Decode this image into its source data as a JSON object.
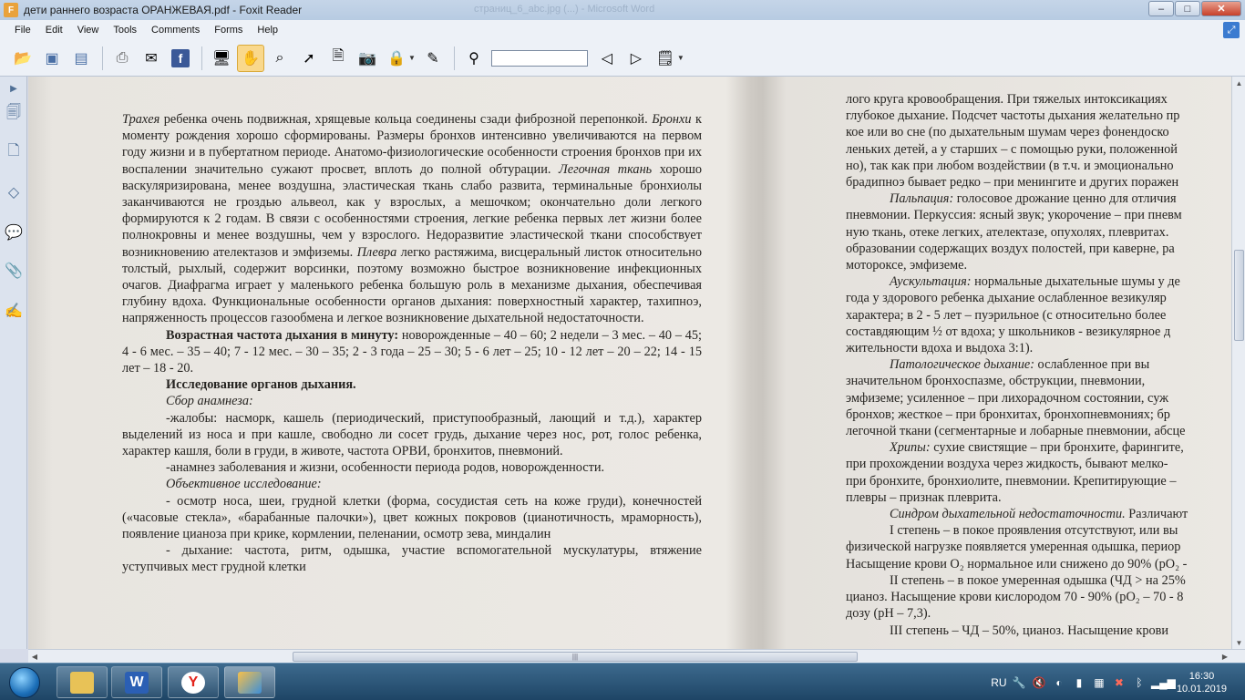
{
  "window": {
    "title": "дети раннего возраста ОРАНЖЕВАЯ.pdf - Foxit Reader",
    "faded_title": "страниц_6_abc.jpg (...) - Microsoft Word",
    "minimize": "–",
    "maximize": "□",
    "close": "✕"
  },
  "menu": [
    "File",
    "Edit",
    "View",
    "Tools",
    "Comments",
    "Forms",
    "Help"
  ],
  "toolbar": {
    "search_value": "",
    "icons": [
      "open-folder",
      "save",
      "save-as",
      "print",
      "email",
      "facebook",
      "monitor",
      "hand-tool",
      "zoom-selection",
      "select-pointer",
      "text-select",
      "snapshot",
      "rms-lock",
      "typewriter",
      "binoculars",
      "prev-search",
      "next-search",
      "export"
    ]
  },
  "document": {
    "left_page": [
      {
        "parts": [
          {
            "t": "Трахея",
            "s": "i"
          },
          {
            "t": " ребенка очень подвижная, хрящевые кольца соединены сзади фиброзной перепонкой. "
          },
          {
            "t": "Бронхи",
            "s": "i"
          },
          {
            "t": " к моменту рождения хорошо сформированы. Размеры бронхов интенсивно увеличиваются на первом году жизни и в пубертатном периоде. Анатомо-физиологические особенности строения бронхов при их воспалении значительно сужают просвет, вплоть до полной обтурации. "
          },
          {
            "t": "Легочная ткань",
            "s": "i"
          },
          {
            "t": " хорошо васкуляризирована, менее воздушна, эластическая ткань слабо развита, терминальные бронхиолы заканчиваются не гроздью альвеол, как у взрослых, а мешочком; окончательно доли легкого формируются к 2 годам. В связи с особенностями строения, легкие ребенка первых лет жизни более полнокровны и менее воздушны, чем у взрослого. Недоразвитие эластической ткани способствует возникновению ателектазов и эмфиземы. "
          },
          {
            "t": "Плевра",
            "s": "i"
          },
          {
            "t": " легко растяжима, висцеральный листок относительно толстый, рыхлый, содержит ворсинки, поэтому возможно быстрое возникновение инфекционных очагов. Диафрагма играет  у маленького ребенка большую роль в механизме дыхания, обеспечивая глубину вдоха. Функциональные особенности органов дыхания: поверхностный характер, тахипноэ, напряженность процессов газообмена и легкое возникновение дыхательной недостаточности."
          }
        ]
      },
      {
        "indent": true,
        "parts": [
          {
            "t": "Возрастная частота дыхания в минуту:",
            "s": "b"
          },
          {
            "t": " новорожденные – 40 – 60; 2 недели – 3 мес. – 40 – 45; 4 - 6 мес. – 35 – 40; 7 - 12 мес. – 30 – 35; 2 - 3 года – 25 – 30; 5 - 6 лет – 25; 10 - 12 лет – 20 – 22; 14 - 15 лет – 18 - 20."
          }
        ]
      },
      {
        "indent": true,
        "parts": [
          {
            "t": "Исследование органов дыхания.",
            "s": "b"
          }
        ]
      },
      {
        "indent": true,
        "parts": [
          {
            "t": "Сбор анамнеза:",
            "s": "i"
          }
        ]
      },
      {
        "indent": true,
        "parts": [
          {
            "t": "-жалобы: насморк, кашель (периодический, приступообразный, лающий и т.д.), характер выделений из носа и при кашле, свободно ли сосет грудь, дыхание через нос, рот, голос ребенка, характер кашля, боли в груди, в животе, частота ОРВИ, бронхитов, пневмоний."
          }
        ]
      },
      {
        "indent": true,
        "parts": [
          {
            "t": "-анамнез заболевания и жизни, особенности периода родов, новорожденности."
          }
        ]
      },
      {
        "indent": true,
        "parts": [
          {
            "t": "Объективное исследование:",
            "s": "i"
          }
        ]
      },
      {
        "indent": true,
        "parts": [
          {
            "t": "- осмотр носа, шеи, грудной клетки (форма, сосудистая сеть на коже груди), конечностей («часовые стекла», «барабанные палочки»), цвет кожных покровов (цианотичность, мраморность), появление цианоза при крике, кормлении, пеленании, осмотр зева, миндалин"
          }
        ]
      },
      {
        "indent": true,
        "parts": [
          {
            "t": "- дыхание: частота, ритм, одышка, участие вспомогательной мускулатуры, втяжение уступчивых мест грудной клетки"
          }
        ]
      }
    ],
    "right_page": [
      {
        "parts": [
          {
            "t": "лого круга кровообращения. При тяжелых интоксикациях"
          }
        ]
      },
      {
        "parts": [
          {
            "t": "глубокое дыхание. Подсчет частоты дыхания желательно пр"
          }
        ]
      },
      {
        "parts": [
          {
            "t": "кое или во сне (по дыхательным шумам через фонендоско"
          }
        ]
      },
      {
        "parts": [
          {
            "t": "леньких детей, а у старших – с помощью руки, положенной"
          }
        ]
      },
      {
        "parts": [
          {
            "t": "но), так как при любом воздействии (в т.ч. и эмоционально"
          }
        ]
      },
      {
        "parts": [
          {
            "t": "брадипноэ бывает редко – при менингите и других поражен"
          }
        ]
      },
      {
        "indent": true,
        "parts": [
          {
            "t": "Пальпация:",
            "s": "i"
          },
          {
            "t": " голосовое дрожание ценно для отличия"
          }
        ]
      },
      {
        "parts": [
          {
            "t": "пневмонии. Перкуссия: ясный звук; укорочение – при пневм"
          }
        ]
      },
      {
        "parts": [
          {
            "t": "ную ткань, отеке легких, ателектазе, опухолях, плевритах."
          }
        ]
      },
      {
        "parts": [
          {
            "t": "образовании содержащих воздух полостей, при каверне, ра"
          }
        ]
      },
      {
        "parts": [
          {
            "t": "моторoксе, эмфиземе."
          }
        ]
      },
      {
        "indent": true,
        "parts": [
          {
            "t": "Аускультация:",
            "s": "i"
          },
          {
            "t": " нормальные дыхательные шумы у де"
          }
        ]
      },
      {
        "parts": [
          {
            "t": "года у здорового ребенка дыхание ослабленное везикуляр"
          }
        ]
      },
      {
        "parts": [
          {
            "t": "характера; в 2 - 5 лет – пуэрильное (с относительно более"
          }
        ]
      },
      {
        "parts": [
          {
            "t": "составдяющим ½ от вдоха;  у школьников - везикулярное д"
          }
        ]
      },
      {
        "parts": [
          {
            "t": "жительности вдоха и выдоха 3:1)."
          }
        ]
      },
      {
        "indent": true,
        "parts": [
          {
            "t": "Патологическое дыхание:",
            "s": "i"
          },
          {
            "t": " ослабленное при вы"
          }
        ]
      },
      {
        "parts": [
          {
            "t": "значительном бронхоспазме, обструкции, пневмонии,"
          }
        ]
      },
      {
        "parts": [
          {
            "t": "эмфиземе; усиленное – при лихорадочном состоянии, суж"
          }
        ]
      },
      {
        "parts": [
          {
            "t": "бронхов; жесткое – при бронхитах, бронхопневмониях; бр"
          }
        ]
      },
      {
        "parts": [
          {
            "t": "легочной ткани (сегментарные и лобарные пневмонии, абсце"
          }
        ]
      },
      {
        "indent": true,
        "parts": [
          {
            "t": "Хрипы:",
            "s": "i"
          },
          {
            "t": " сухие свистящие – при бронхите, фарингите,"
          }
        ]
      },
      {
        "parts": [
          {
            "t": "при прохождении воздуха через жидкость, бывают мелко-"
          }
        ]
      },
      {
        "parts": [
          {
            "t": "при бронхите, бронхиолите, пневмонии. Крепитирующие –"
          }
        ]
      },
      {
        "parts": [
          {
            "t": "плевры – признак плеврита."
          }
        ]
      },
      {
        "indent": true,
        "parts": [
          {
            "t": "Синдром дыхательной недостаточности.",
            "s": "i"
          },
          {
            "t": " Различают"
          }
        ]
      },
      {
        "indent": true,
        "parts": [
          {
            "t": "I степень – в покое проявления отсутствуют, или вы"
          }
        ]
      },
      {
        "parts": [
          {
            "t": "физической нагрузке появляется умеренная одышка, периор"
          }
        ]
      },
      {
        "parts": [
          {
            "t": "Насыщение крови O₂ нормальное или снижено до 90% (pO₂ -"
          }
        ]
      },
      {
        "indent": true,
        "parts": [
          {
            "t": "II степень – в покое умеренная одышка (ЧД > на 25%"
          }
        ]
      },
      {
        "parts": [
          {
            "t": "цианоз. Насыщение крови кислородом 70 - 90% (pO₂ – 70 - 8"
          }
        ]
      },
      {
        "parts": [
          {
            "t": "дозу (pH – 7,3)."
          }
        ]
      },
      {
        "indent": true,
        "parts": [
          {
            "t": "III степень – ЧД – 50%, цианоз. Насыщение крови"
          }
        ]
      }
    ]
  },
  "taskbar": {
    "apps": [
      {
        "name": "explorer",
        "label": ""
      },
      {
        "name": "word",
        "label": "W"
      },
      {
        "name": "yandex",
        "label": "Y"
      },
      {
        "name": "foxit",
        "label": ""
      }
    ],
    "language": "RU",
    "time": "16:30",
    "date": "10.01.2019"
  }
}
